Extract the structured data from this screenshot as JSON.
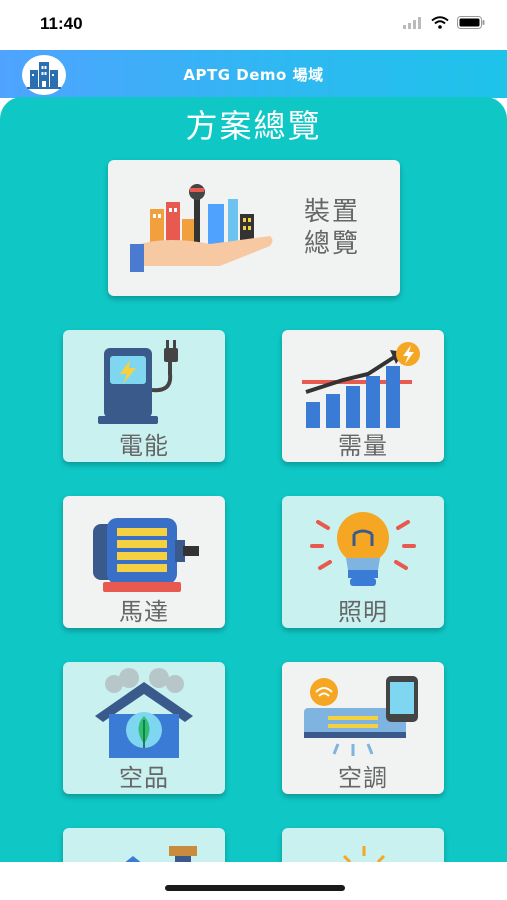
{
  "status_bar": {
    "time": "11:40"
  },
  "header": {
    "title": "APTG Demo 場域"
  },
  "page": {
    "title": "方案總覽"
  },
  "feature": {
    "label_line1": "裝置",
    "label_line2": "總覽"
  },
  "tiles": [
    {
      "label": "電能",
      "icon": "ev-charger-icon"
    },
    {
      "label": "需量",
      "icon": "demand-chart-icon"
    },
    {
      "label": "馬達",
      "icon": "motor-icon"
    },
    {
      "label": "照明",
      "icon": "light-bulb-icon"
    },
    {
      "label": "空品",
      "icon": "air-quality-house-icon"
    },
    {
      "label": "空調",
      "icon": "air-conditioner-icon"
    }
  ],
  "colors": {
    "accent": "#0fc8c6",
    "header_start": "#4fa3ff",
    "header_end": "#1ec3ea",
    "tile_light": "#f1f3f3",
    "tile_mint": "#c9f1f0"
  }
}
